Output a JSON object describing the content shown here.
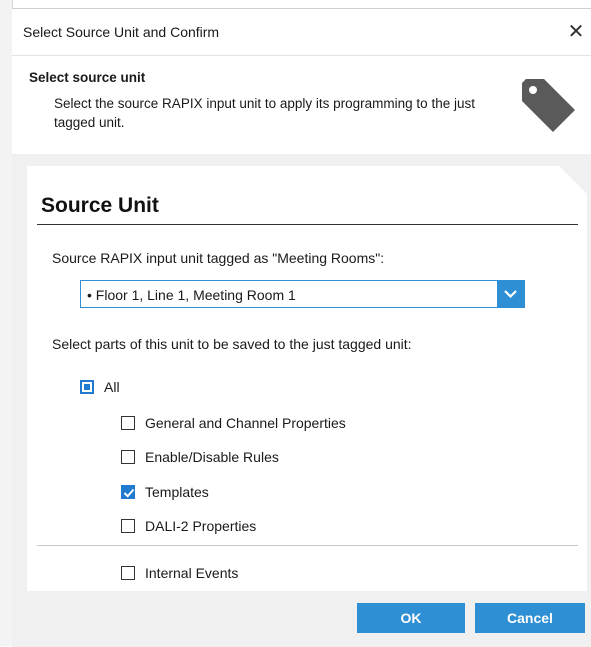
{
  "window": {
    "title": "Select Source Unit and Confirm",
    "close_glyph": "✕"
  },
  "header": {
    "title": "Select source unit",
    "description": "Select the source RAPIX input unit to apply its programming to the just tagged unit.",
    "icon": "tag-icon"
  },
  "panel": {
    "title": "Source Unit",
    "source_label": "Source RAPIX input unit tagged as \"Meeting Rooms\":",
    "dropdown_value": "• Floor 1, Line 1, Meeting Room 1",
    "parts_label": "Select parts of this unit to be saved to the just tagged unit:",
    "all": {
      "label": "All",
      "state": "partial"
    },
    "options": [
      {
        "label": "General and Channel Properties",
        "checked": false
      },
      {
        "label": "Enable/Disable Rules",
        "checked": false
      },
      {
        "label": "Templates",
        "checked": true
      },
      {
        "label": "DALI-2 Properties",
        "checked": false
      }
    ],
    "internal_events": {
      "label": "Internal Events",
      "checked": false
    }
  },
  "buttons": {
    "ok": "OK",
    "cancel": "Cancel"
  },
  "colors": {
    "accent": "#2f8fd5",
    "check": "#1f7ad0",
    "body_bg": "#f0f0f0"
  }
}
